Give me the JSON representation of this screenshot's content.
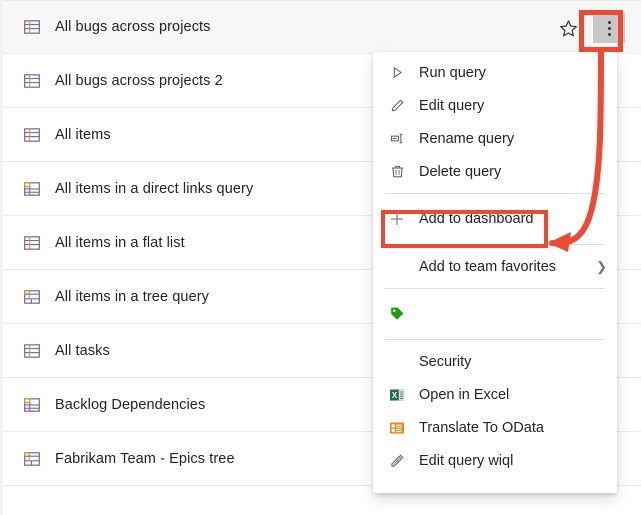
{
  "accent": {
    "annotation_red": "#ec4a33",
    "text": "#242424",
    "row_separator": "#edebe9",
    "selected_row_bg": "#f7f7f7",
    "more_button_bg": "#c8c8c8",
    "excel_green": "#1e7145",
    "odata_orange": "#f2861e",
    "tag_green": "#13a10e"
  },
  "query_list": {
    "rows": [
      {
        "label": "All bugs across projects",
        "icon": "flat-list-query-icon",
        "selected": true
      },
      {
        "label": "All bugs across projects 2",
        "icon": "flat-list-query-icon",
        "selected": false
      },
      {
        "label": "All items",
        "icon": "flat-list-query-icon",
        "selected": false
      },
      {
        "label": "All items in a direct links query",
        "icon": "direct-links-query-icon",
        "selected": false
      },
      {
        "label": "All items in a flat list",
        "icon": "flat-list-query-icon",
        "selected": false
      },
      {
        "label": "All items in a tree query",
        "icon": "tree-query-icon",
        "selected": false
      },
      {
        "label": "All tasks",
        "icon": "flat-list-query-icon",
        "selected": false
      },
      {
        "label": "Backlog Dependencies",
        "icon": "direct-links-query-icon",
        "selected": false
      },
      {
        "label": "Fabrikam Team - Epics tree",
        "icon": "tree-query-icon",
        "selected": false
      }
    ],
    "row_actions": {
      "favorite_icon": "star-outline-icon",
      "more_icon": "more-vertical-icon"
    }
  },
  "context_menu": {
    "items": [
      {
        "label": "Run query",
        "icon": "play-icon",
        "type": "item"
      },
      {
        "label": "Edit query",
        "icon": "pencil-icon",
        "type": "item"
      },
      {
        "label": "Rename query",
        "icon": "rename-icon",
        "type": "item"
      },
      {
        "label": "Delete query",
        "icon": "trash-icon",
        "type": "item"
      },
      {
        "label": "",
        "icon": "",
        "type": "separator"
      },
      {
        "label": "Add to dashboard",
        "icon": "plus-icon",
        "type": "item",
        "highlighted": true
      },
      {
        "label": "",
        "icon": "",
        "type": "separator"
      },
      {
        "label": "Add to team favorites",
        "icon": "",
        "type": "submenu",
        "chevron": "chevron-right-icon"
      },
      {
        "label": "",
        "icon": "",
        "type": "separator"
      },
      {
        "label": "",
        "icon": "tag-icon",
        "type": "item"
      },
      {
        "label": "",
        "icon": "",
        "type": "separator"
      },
      {
        "label": "Security",
        "icon": "",
        "type": "item"
      },
      {
        "label": "Open in Excel",
        "icon": "excel-icon",
        "type": "item"
      },
      {
        "label": "Translate To OData",
        "icon": "odata-icon",
        "type": "item"
      },
      {
        "label": "Edit query wiql",
        "icon": "edit-wiql-icon",
        "type": "item"
      }
    ]
  },
  "annotations": {
    "more_button_box": "red-highlight-box",
    "dashboard_box": "red-highlight-box",
    "arrow": "red-curved-arrow"
  }
}
